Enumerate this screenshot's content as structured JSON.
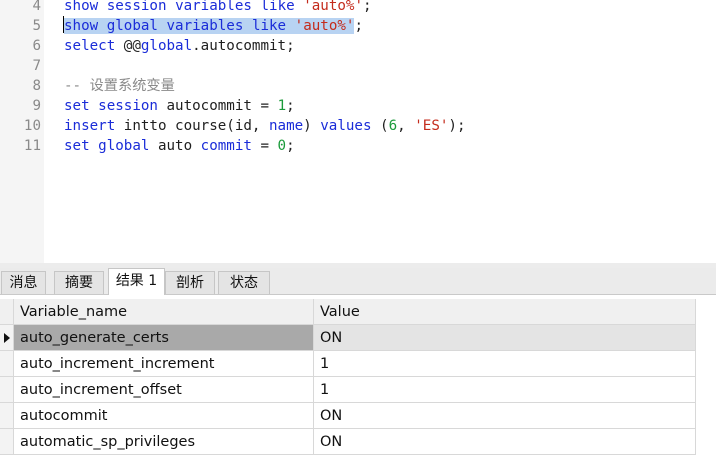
{
  "editor": {
    "lines": [
      {
        "num": "4",
        "parts": [
          {
            "t": "show",
            "k": "kw"
          },
          {
            "t": " ",
            "k": ""
          },
          {
            "t": "session",
            "k": "kw"
          },
          {
            "t": " ",
            "k": ""
          },
          {
            "t": "variables",
            "k": "kw"
          },
          {
            "t": " ",
            "k": ""
          },
          {
            "t": "like",
            "k": "kw"
          },
          {
            "t": " ",
            "k": ""
          },
          {
            "t": "'auto%'",
            "k": "str"
          },
          {
            "t": ";",
            "k": ""
          }
        ]
      },
      {
        "num": "5",
        "parts": [
          {
            "t": "show",
            "k": "kw sel"
          },
          {
            "t": " ",
            "k": "sel"
          },
          {
            "t": "global",
            "k": "kw sel"
          },
          {
            "t": " ",
            "k": "sel"
          },
          {
            "t": "variables",
            "k": "kw sel"
          },
          {
            "t": " ",
            "k": "sel"
          },
          {
            "t": "like",
            "k": "kw sel"
          },
          {
            "t": " ",
            "k": "sel"
          },
          {
            "t": "'auto%'",
            "k": "str sel"
          },
          {
            "t": ";",
            "k": ""
          }
        ]
      },
      {
        "num": "6",
        "parts": [
          {
            "t": "select",
            "k": "kw"
          },
          {
            "t": " @@",
            "k": ""
          },
          {
            "t": "global",
            "k": "kw"
          },
          {
            "t": ".autocommit;",
            "k": ""
          }
        ]
      },
      {
        "num": "7",
        "parts": []
      },
      {
        "num": "8",
        "parts": [
          {
            "t": "-- 设置系统变量",
            "k": "cm"
          }
        ]
      },
      {
        "num": "9",
        "parts": [
          {
            "t": "set",
            "k": "kw"
          },
          {
            "t": " ",
            "k": ""
          },
          {
            "t": "session",
            "k": "kw"
          },
          {
            "t": " autocommit = ",
            "k": ""
          },
          {
            "t": "1",
            "k": "num"
          },
          {
            "t": ";",
            "k": ""
          }
        ]
      },
      {
        "num": "10",
        "parts": [
          {
            "t": "insert",
            "k": "kw"
          },
          {
            "t": " intto course(id, ",
            "k": ""
          },
          {
            "t": "name",
            "k": "kw"
          },
          {
            "t": ") ",
            "k": ""
          },
          {
            "t": "values",
            "k": "kw"
          },
          {
            "t": " (",
            "k": ""
          },
          {
            "t": "6",
            "k": "num"
          },
          {
            "t": ", ",
            "k": ""
          },
          {
            "t": "'ES'",
            "k": "str"
          },
          {
            "t": ");",
            "k": ""
          }
        ]
      },
      {
        "num": "11",
        "parts": [
          {
            "t": "set",
            "k": "kw"
          },
          {
            "t": " ",
            "k": ""
          },
          {
            "t": "global",
            "k": "kw"
          },
          {
            "t": " auto ",
            "k": ""
          },
          {
            "t": "commit",
            "k": "kw"
          },
          {
            "t": " = ",
            "k": ""
          },
          {
            "t": "0",
            "k": "num"
          },
          {
            "t": ";",
            "k": ""
          }
        ]
      }
    ]
  },
  "tabs": [
    {
      "label": "消息",
      "active": false
    },
    {
      "label": "摘要",
      "active": false
    },
    {
      "label": "结果 1",
      "active": true
    },
    {
      "label": "剖析",
      "active": false
    },
    {
      "label": "状态",
      "active": false
    }
  ],
  "grid": {
    "columns": [
      "Variable_name",
      "Value"
    ],
    "rows": [
      [
        "auto_generate_certs",
        "ON"
      ],
      [
        "auto_increment_increment",
        "1"
      ],
      [
        "auto_increment_offset",
        "1"
      ],
      [
        "autocommit",
        "ON"
      ],
      [
        "automatic_sp_privileges",
        "ON"
      ]
    ],
    "selected_row": 0
  }
}
